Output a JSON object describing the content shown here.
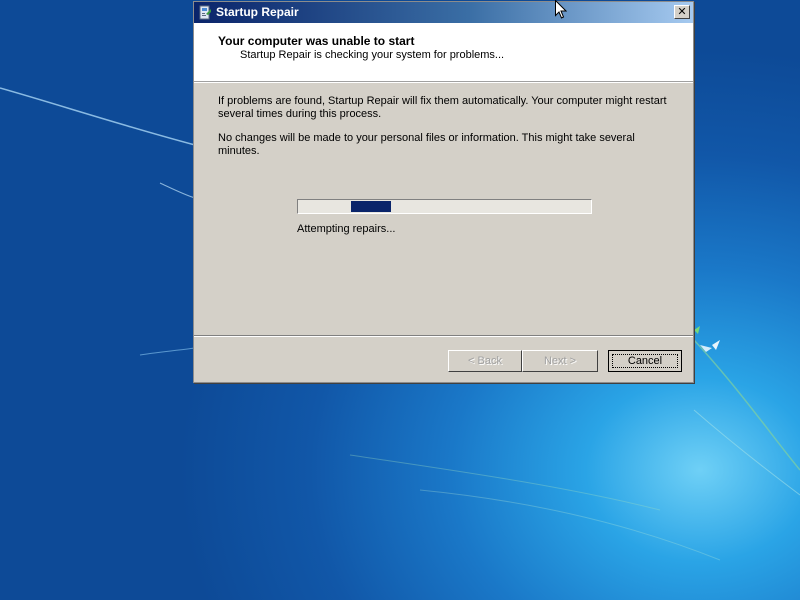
{
  "window": {
    "title": "Startup Repair",
    "close_glyph": "✕"
  },
  "header": {
    "title": "Your computer was unable to start",
    "subtitle": "Startup Repair is checking your system for problems..."
  },
  "body": {
    "paragraph1": "If problems are found, Startup Repair will fix them automatically. Your computer might restart several times during this process.",
    "paragraph2": "No changes will be made to your personal files or information. This might take several minutes."
  },
  "progress": {
    "style": "marquee",
    "chunk_start_fraction": 0.18,
    "chunk_width_fraction": 0.135,
    "status": "Attempting repairs..."
  },
  "buttons": {
    "back": {
      "label": "< Back",
      "enabled": false
    },
    "next": {
      "label": "Next >",
      "enabled": false
    },
    "cancel": {
      "label": "Cancel",
      "enabled": true,
      "default": true
    }
  },
  "colors": {
    "dialog_face": "#d4d0c8",
    "titlebar_start": "#0a246a",
    "titlebar_end": "#a6caf0",
    "progress_fill": "#0a246a",
    "desktop": "#1a78c8"
  },
  "icons": {
    "title_icon": "startup-repair-icon",
    "close": "close-icon",
    "cursor": "mouse-pointer-icon"
  }
}
